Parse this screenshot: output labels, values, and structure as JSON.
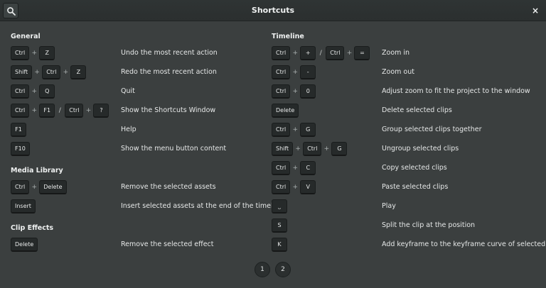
{
  "window": {
    "title": "Shortcuts",
    "close_glyph": "×"
  },
  "general": {
    "title": "General",
    "rows": [
      {
        "keys": [
          "Ctrl",
          "+",
          "Z"
        ],
        "desc": "Undo the most recent action"
      },
      {
        "keys": [
          "Shift",
          "+",
          "Ctrl",
          "+",
          "Z"
        ],
        "desc": "Redo the most recent action"
      },
      {
        "keys": [
          "Ctrl",
          "+",
          "Q"
        ],
        "desc": "Quit"
      },
      {
        "keys": [
          "Ctrl",
          "+",
          "F1",
          "/",
          "Ctrl",
          "+",
          "?"
        ],
        "desc": "Show the Shortcuts Window"
      },
      {
        "keys": [
          "F1"
        ],
        "desc": "Help"
      },
      {
        "keys": [
          "F10"
        ],
        "desc": "Show the menu button content"
      }
    ]
  },
  "media": {
    "title": "Media Library",
    "rows": [
      {
        "keys": [
          "Ctrl",
          "+",
          "Delete"
        ],
        "desc": "Remove the selected assets"
      },
      {
        "keys": [
          "Insert"
        ],
        "desc": "Insert selected assets at the end of the timeline"
      }
    ]
  },
  "clip": {
    "title": "Clip Effects",
    "rows": [
      {
        "keys": [
          "Delete"
        ],
        "desc": "Remove the selected effect"
      }
    ]
  },
  "timeline": {
    "title": "Timeline",
    "rows": [
      {
        "keys": [
          "Ctrl",
          "+",
          "+",
          "/",
          "Ctrl",
          "+",
          "="
        ],
        "desc": "Zoom in"
      },
      {
        "keys": [
          "Ctrl",
          "+",
          "-"
        ],
        "desc": "Zoom out"
      },
      {
        "keys": [
          "Ctrl",
          "+",
          "0"
        ],
        "desc": "Adjust zoom to fit the project to the window"
      },
      {
        "keys": [
          "Delete"
        ],
        "desc": "Delete selected clips"
      },
      {
        "keys": [
          "Ctrl",
          "+",
          "G"
        ],
        "desc": "Group selected clips together"
      },
      {
        "keys": [
          "Shift",
          "+",
          "Ctrl",
          "+",
          "G"
        ],
        "desc": "Ungroup selected clips"
      },
      {
        "keys": [
          "Ctrl",
          "+",
          "C"
        ],
        "desc": "Copy selected clips"
      },
      {
        "keys": [
          "Ctrl",
          "+",
          "V"
        ],
        "desc": "Paste selected clips"
      },
      {
        "keys": [
          "⎵"
        ],
        "desc": "Play"
      },
      {
        "keys": [
          "S"
        ],
        "desc": "Split the clip at the position"
      },
      {
        "keys": [
          "K"
        ],
        "desc": "Add keyframe to the keyframe curve of selected clip"
      }
    ]
  },
  "pages": [
    "1",
    "2"
  ]
}
